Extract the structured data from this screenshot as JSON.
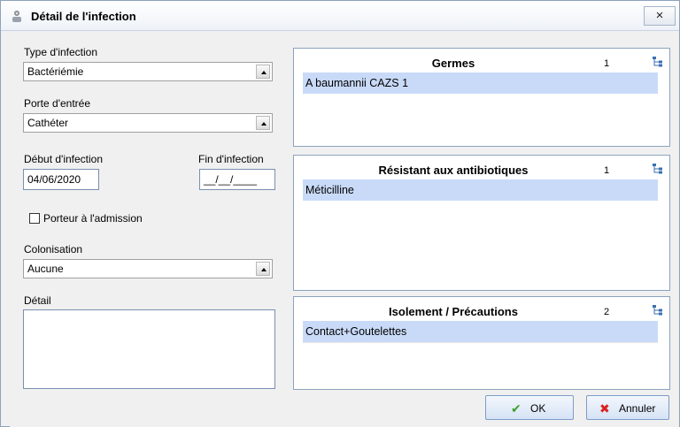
{
  "window": {
    "title": "Détail de l'infection",
    "close_label": "×"
  },
  "form": {
    "type_infection": {
      "label": "Type d'infection",
      "value": "Bactériémie"
    },
    "porte_entree": {
      "label": "Porte d'entrée",
      "value": "Cathéter"
    },
    "debut_infection": {
      "label": "Début d'infection",
      "value": "04/06/2020"
    },
    "fin_infection": {
      "label": "Fin d'infection",
      "value": "__/__/____"
    },
    "porteur_admission": {
      "label": "Porteur à l'admission",
      "checked": false
    },
    "colonisation": {
      "label": "Colonisation",
      "value": "Aucune"
    },
    "detail": {
      "label": "Détail",
      "value": ""
    }
  },
  "panels": {
    "germes": {
      "title": "Germes",
      "count": "1",
      "items": [
        "A baumannii CAZS 1"
      ]
    },
    "resistant": {
      "title": "Résistant aux antibiotiques",
      "count": "1",
      "items": [
        "Méticilline"
      ]
    },
    "isolement": {
      "title": "Isolement / Précautions",
      "count": "2",
      "items": [
        "Contact+Goutelettes",
        ""
      ]
    }
  },
  "buttons": {
    "ok": "OK",
    "annuler": "Annuler"
  },
  "colors": {
    "selection_row": "#c9daf8",
    "ok_check": "#3aa12d",
    "cancel_x": "#d92020"
  }
}
